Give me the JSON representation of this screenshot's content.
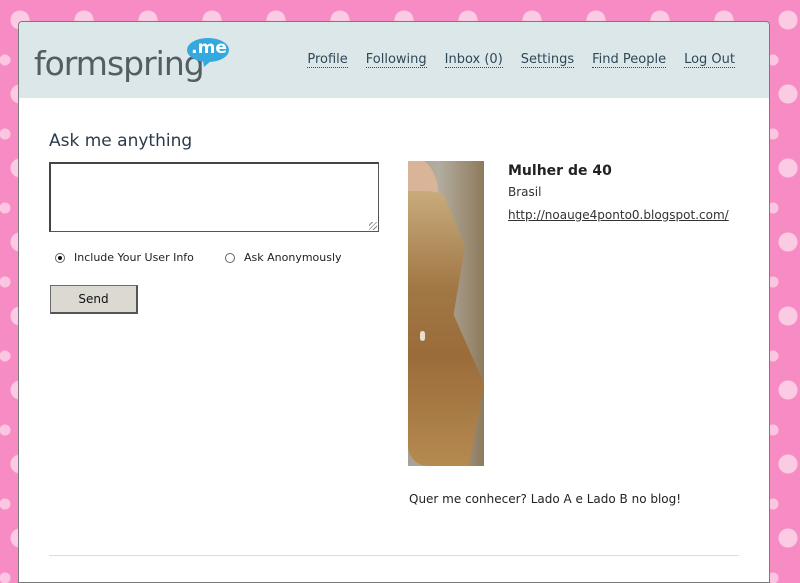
{
  "logo": {
    "word": "formspring",
    "bubble": ".me"
  },
  "nav": {
    "profile": "Profile",
    "following": "Following",
    "inbox": "Inbox (0)",
    "settings": "Settings",
    "find_people": "Find People",
    "log_out": "Log Out"
  },
  "ask": {
    "title": "Ask me anything",
    "question_value": "",
    "include_info_label": "Include Your User Info",
    "anonymous_label": "Ask Anonymously",
    "selected_option": "Include Your User Info",
    "send_label": "Send"
  },
  "profile": {
    "name": "Mulher de 40",
    "location": "Brasil",
    "url": "http://noauge4ponto0.blogspot.com/",
    "bio": "Quer me conhecer? Lado A e Lado B no blog!"
  },
  "colors": {
    "background": "#f78cc4",
    "header": "#dbe7e8",
    "logo_bubble": "#35a8de",
    "logo_text": "#555d63"
  }
}
